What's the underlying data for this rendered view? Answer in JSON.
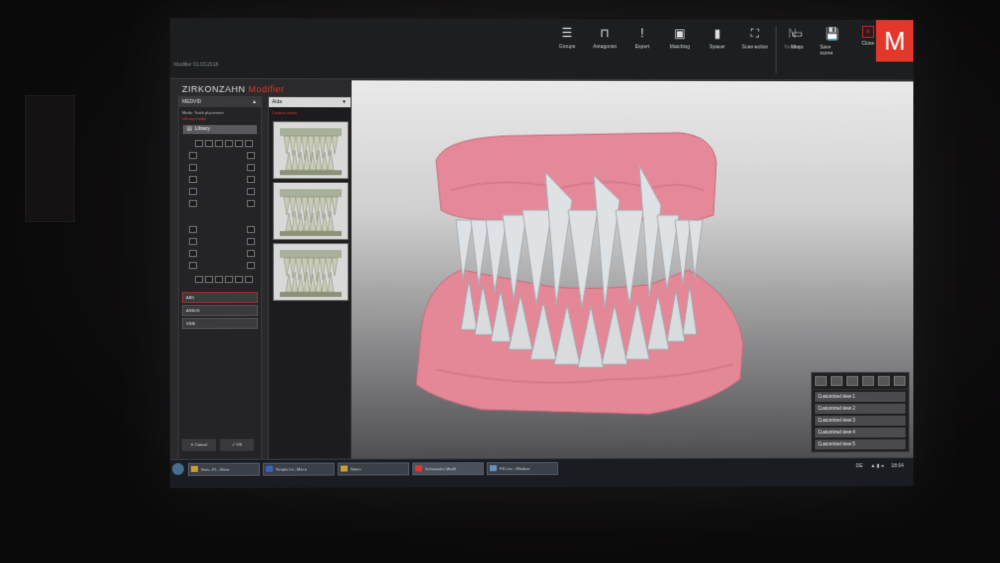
{
  "window": {
    "badge": "Modifier 01.03.2018"
  },
  "brand": {
    "name": "ZIRKONZAHN",
    "product": "Modifier"
  },
  "toolbar": {
    "items": [
      {
        "label": "Groups",
        "icon": "groups-icon"
      },
      {
        "label": "Antagonist",
        "icon": "antagonist-icon"
      },
      {
        "label": "Expert",
        "icon": "expert-icon"
      },
      {
        "label": "Matching",
        "icon": "matching-icon"
      },
      {
        "label": "Spacer",
        "icon": "spacer-icon"
      },
      {
        "label": "Scan-action",
        "icon": "scan-action-icon"
      },
      {
        "label": "Nesting",
        "icon": "nesting-icon",
        "dim": true
      }
    ],
    "right_items": [
      {
        "label": "Menu",
        "icon": "menu-icon"
      },
      {
        "label": "Save scene",
        "icon": "save-icon"
      },
      {
        "label": "Close",
        "icon": "close-icon"
      }
    ],
    "logo": "M"
  },
  "left_panel": {
    "header": "MEDVID",
    "sub1": "Mode: Tooth placement",
    "sub2": "Library model",
    "library_label": "Library",
    "sections": [
      "ABN",
      "ARBUS",
      "SINE"
    ],
    "cancel_label": "Cancel",
    "ok_label": "OK"
  },
  "mid_panel": {
    "header": "Aida",
    "note": "Custom views"
  },
  "views_panel": {
    "buttons": [
      "Customized view 1",
      "Customized view 2",
      "Customized view 3",
      "Customized view 4",
      "Customized view 5"
    ]
  },
  "taskbar": {
    "tasks": [
      "Serv...FL - Brow",
      "Scripts Ist - Micro",
      "Notes",
      "Zirkonzahn Modif",
      "FS Lite - Window"
    ],
    "tray_lang": "DE",
    "time": "18:04"
  },
  "colors": {
    "accent": "#e2372a",
    "gum": "#e98a98",
    "tooth": "#dfe2e4"
  }
}
